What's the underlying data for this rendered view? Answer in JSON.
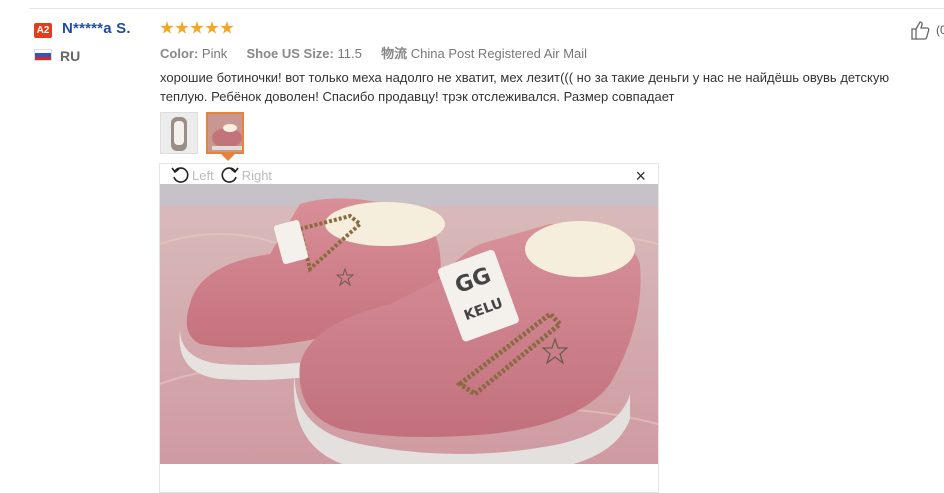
{
  "reviewer": {
    "level": "A2",
    "name": "N*****a S.",
    "country": "RU"
  },
  "rating": {
    "stars": 5
  },
  "meta": {
    "color_label": "Color:",
    "color_value": "Pink",
    "size_label": "Shoe US Size:",
    "size_value": "11.5",
    "shipping_label": "物流",
    "shipping_value": "China Post Registered Air Mail"
  },
  "review_text": "хорошие ботиночки! вот только меха надолго не хватит, мех лезит((( но за такие деньги у нас не найдёшь овувь детскую теплую. Ребёнок доволен! Спасибо продавцу! трэк отслеживался. Размер совпадает",
  "helpful": {
    "count_text": "(0"
  },
  "viewer": {
    "rotate_left": "Left",
    "rotate_right": "Right",
    "close": "×"
  },
  "photo": {
    "label_text": "KELU"
  },
  "colors": {
    "accent": "#e6823a",
    "name": "#1e4e9e",
    "star": "#f5a623",
    "badge": "#e43d1b"
  }
}
